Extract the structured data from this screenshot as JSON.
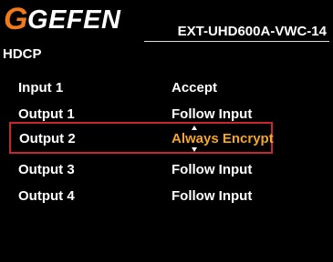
{
  "header": {
    "logo_g": "G",
    "logo_text": "GEFEN",
    "model": "EXT-UHD600A-VWC-14"
  },
  "colors": {
    "accent": "#f07a1a",
    "selected_value": "#f5a623",
    "selection_border": "#c8262e"
  },
  "section": {
    "title": "HDCP"
  },
  "rows": [
    {
      "label": "Input 1",
      "value": "Accept"
    },
    {
      "label": "Output 1",
      "value": "Follow Input"
    },
    {
      "label": "Output 2",
      "value": "Always Encrypt"
    },
    {
      "label": "Output 3",
      "value": "Follow Input"
    },
    {
      "label": "Output 4",
      "value": "Follow Input"
    }
  ]
}
